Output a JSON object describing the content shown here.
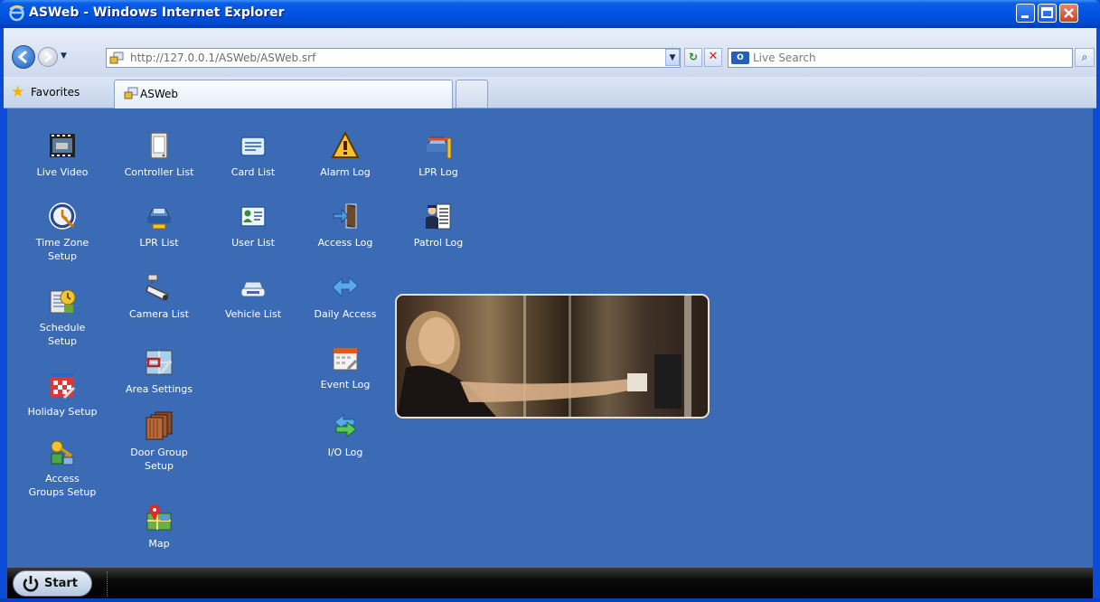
{
  "window": {
    "title": "ASWeb - Windows Internet Explorer",
    "icon": "ie-logo-icon"
  },
  "navigation": {
    "address": "http://127.0.0.1/ASWeb/ASWeb.srf",
    "search_placeholder": "Live Search"
  },
  "favorites_bar": {
    "favorites_label": "Favorites",
    "tab_label": "ASWeb"
  },
  "menu": {
    "columns": [
      [
        {
          "label": "Live Video",
          "icon": "film-camera-icon"
        },
        {
          "label": "Time Zone\nSetup",
          "icon": "clock-globe-icon"
        },
        {
          "label": "Schedule\nSetup",
          "icon": "schedule-clock-icon"
        },
        {
          "label": "Holiday Setup",
          "icon": "holiday-calendar-icon"
        },
        {
          "label": "Access\nGroups Setup",
          "icon": "key-group-icon"
        }
      ],
      [
        {
          "label": "Controller List",
          "icon": "controller-panel-icon"
        },
        {
          "label": "LPR List",
          "icon": "car-plate-icon"
        },
        {
          "label": "Camera List",
          "icon": "cctv-camera-icon"
        },
        {
          "label": "Area Settings",
          "icon": "area-map-icon"
        },
        {
          "label": "Door Group\nSetup",
          "icon": "doors-icon"
        },
        {
          "label": "Map",
          "icon": "map-pin-icon"
        }
      ],
      [
        {
          "label": "Card List",
          "icon": "card-icon"
        },
        {
          "label": "User List",
          "icon": "user-card-icon"
        },
        {
          "label": "Vehicle List",
          "icon": "vehicle-icon"
        }
      ],
      [
        {
          "label": "Alarm Log",
          "icon": "warning-triangle-icon"
        },
        {
          "label": "Access Log",
          "icon": "door-enter-icon"
        },
        {
          "label": "Daily Access",
          "icon": "daily-arrows-icon"
        },
        {
          "label": "Event Log",
          "icon": "event-calendar-icon"
        },
        {
          "label": "I/O Log",
          "icon": "io-arrows-icon"
        }
      ],
      [
        {
          "label": "LPR Log",
          "icon": "car-barrier-icon"
        },
        {
          "label": "Patrol Log",
          "icon": "guard-checklist-icon"
        }
      ]
    ]
  },
  "taskbar": {
    "start_label": "Start"
  }
}
